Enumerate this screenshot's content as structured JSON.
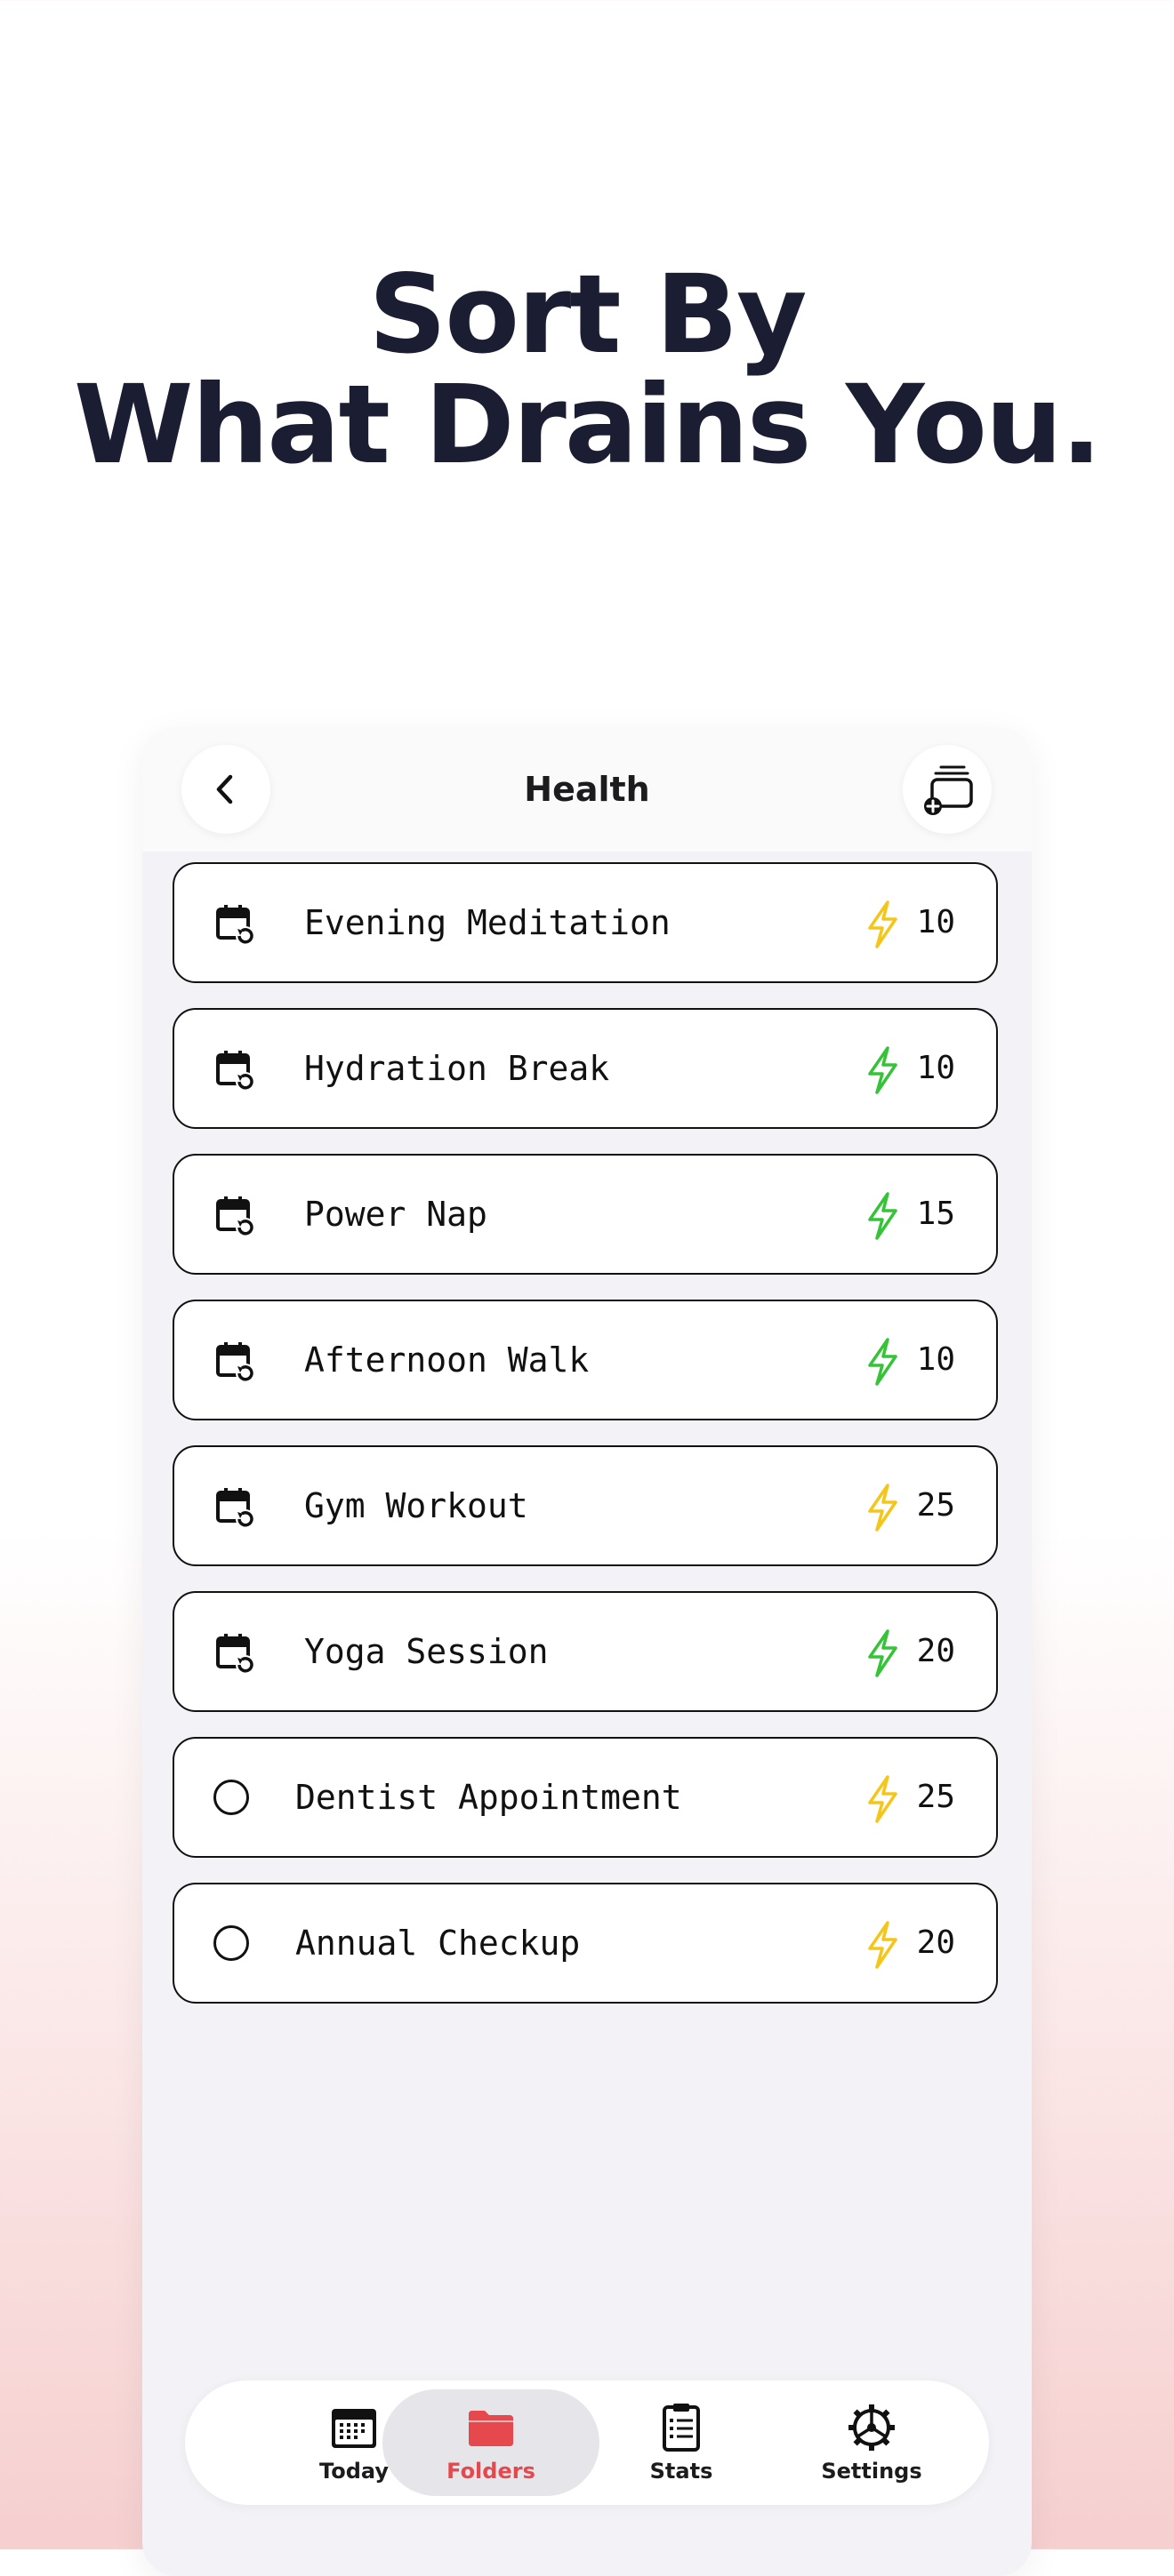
{
  "headline": {
    "line1": "Sort By",
    "line2": "What Drains You."
  },
  "nav": {
    "title": "Health",
    "back_icon": "chevron-left-icon",
    "add_icon": "add-stack-icon"
  },
  "colors": {
    "yellow": "#f5c518",
    "green": "#35c437",
    "accent": "#e5484d"
  },
  "tasks": [
    {
      "name": "Evening Meditation",
      "energy": "10",
      "type": "recurring",
      "level": "yellow"
    },
    {
      "name": "Hydration Break",
      "energy": "10",
      "type": "recurring",
      "level": "green"
    },
    {
      "name": "Power Nap",
      "energy": "15",
      "type": "recurring",
      "level": "green"
    },
    {
      "name": "Afternoon Walk",
      "energy": "10",
      "type": "recurring",
      "level": "green"
    },
    {
      "name": "Gym Workout",
      "energy": "25",
      "type": "recurring",
      "level": "yellow"
    },
    {
      "name": "Yoga Session",
      "energy": "20",
      "type": "recurring",
      "level": "green"
    },
    {
      "name": "Dentist Appointment",
      "energy": "25",
      "type": "single",
      "level": "yellow"
    },
    {
      "name": "Annual Checkup",
      "energy": "20",
      "type": "single",
      "level": "yellow"
    }
  ],
  "tabs": [
    {
      "label": "Today",
      "icon": "calendar-icon",
      "active": false
    },
    {
      "label": "Folders",
      "icon": "folder-icon",
      "active": true
    },
    {
      "label": "Stats",
      "icon": "clipboard-icon",
      "active": false
    },
    {
      "label": "Settings",
      "icon": "gear-icon",
      "active": false
    }
  ]
}
